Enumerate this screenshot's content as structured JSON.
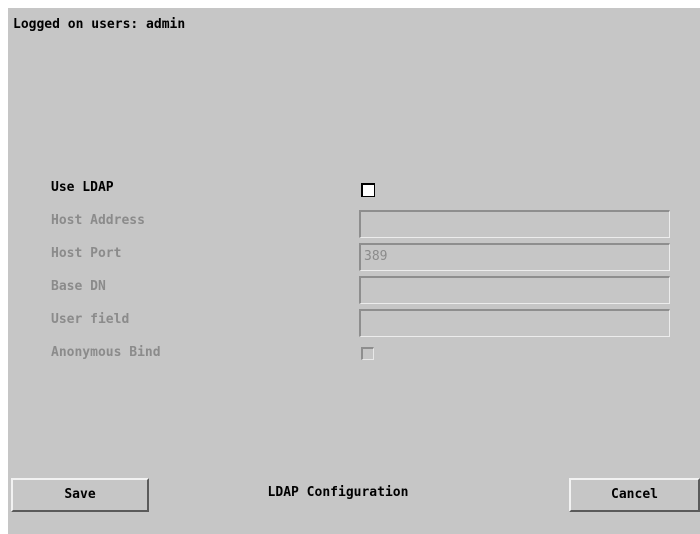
{
  "header": {
    "logged_on": "Logged on users: admin"
  },
  "form": {
    "use_ldap": {
      "label": "Use LDAP",
      "checked": false
    },
    "host_address": {
      "label": "Host Address",
      "value": ""
    },
    "host_port": {
      "label": "Host Port",
      "value": "389"
    },
    "base_dn": {
      "label": "Base DN",
      "value": ""
    },
    "user_field": {
      "label": "User field",
      "value": ""
    },
    "anonymous_bind": {
      "label": "Anonymous Bind",
      "checked": false
    }
  },
  "footer": {
    "save_label": "Save",
    "title": "LDAP Configuration",
    "cancel_label": "Cancel"
  },
  "colors": {
    "panel_bg": "#c6c6c6",
    "enabled_text": "#000000",
    "disabled_text": "#8b8b8b"
  }
}
